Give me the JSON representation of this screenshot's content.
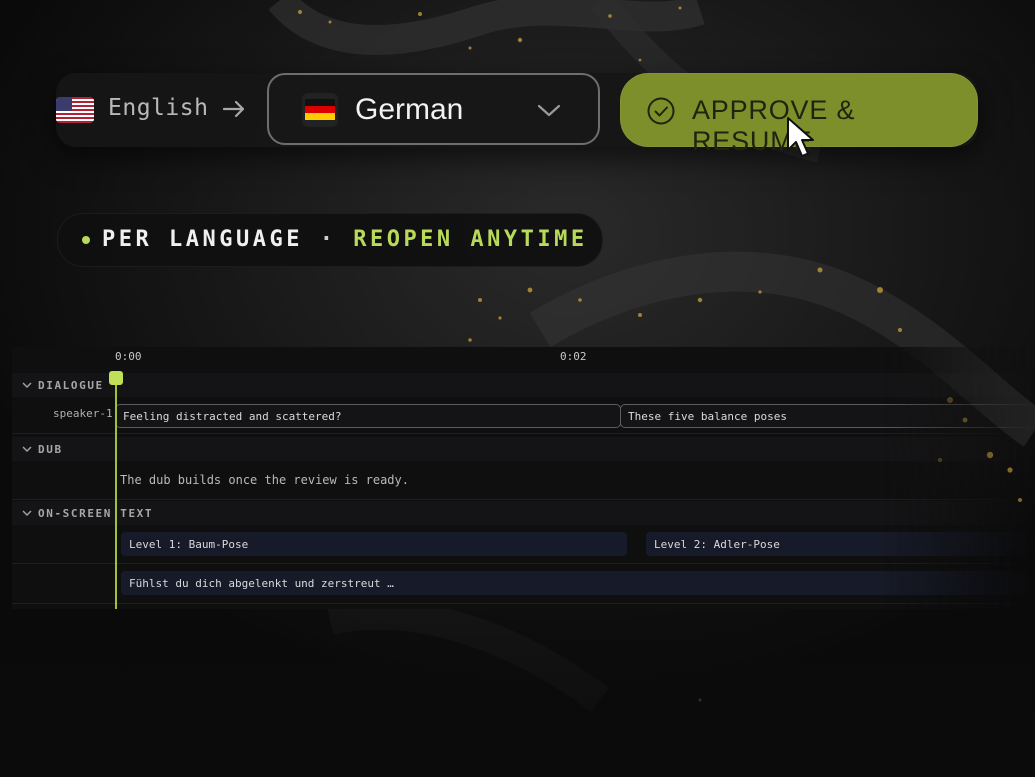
{
  "language_bar": {
    "source_language": "English",
    "source_flag_icon": "us-flag-icon",
    "arrow_icon": "arrow-right-icon",
    "target_language": "German",
    "target_flag_icon": "de-flag-icon",
    "dropdown_icon": "chevron-down-icon",
    "approve_label": "APPROVE & RESUME",
    "approve_icon": "check-circle-icon",
    "accent_color": "#7d8f2b"
  },
  "pill": {
    "part_a": "PER LANGUAGE",
    "separator": "·",
    "part_b": "REOPEN ANYTIME",
    "highlight_color": "#b8da5a"
  },
  "timeline": {
    "ticks": [
      "0:00",
      "0:02"
    ],
    "sections": {
      "dialogue": {
        "label": "DIALOGUE",
        "track_label": "speaker-1",
        "clips": [
          "Feeling distracted and scattered?",
          "These five balance poses"
        ]
      },
      "dub": {
        "label": "DUB",
        "message": "The dub builds once the review is ready."
      },
      "onscreen": {
        "label": "ON-SCREEN TEXT",
        "row1": [
          "Level 1: Baum-Pose",
          "Level 2: Adler-Pose"
        ],
        "row2": [
          "Fühlst du dich abgelenkt und zerstreut …"
        ]
      }
    },
    "playhead_color": "#bfe058"
  }
}
